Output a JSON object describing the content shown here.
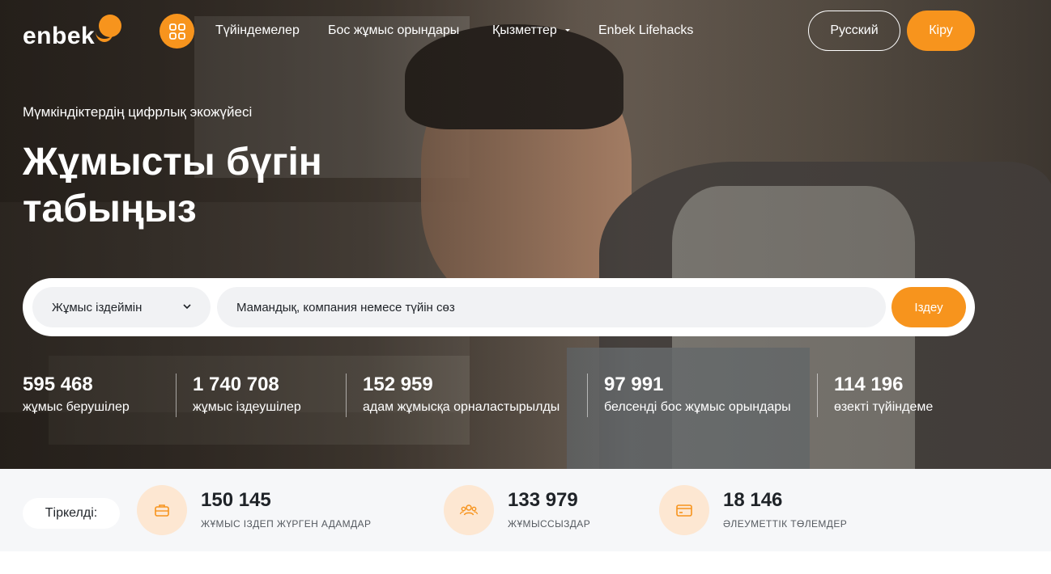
{
  "brand": {
    "logo_text": "enbek",
    "accent": "#f7941d"
  },
  "nav": {
    "apps_icon": "grid-icon",
    "links": [
      "Түйіндемелер",
      "Бос жұмыс орындары",
      "Қызметтер",
      "Enbek Lifehacks"
    ],
    "services_dropdown_icon": "caret-down-icon",
    "language_button": "Русский",
    "login_button": "Кіру"
  },
  "hero": {
    "subtitle": "Мүмкіндіктердің цифрлық экожүйесі",
    "headline": "Жұмысты бүгін табыңыз"
  },
  "search": {
    "select_value": "Жұмыс іздеймін",
    "input_placeholder": "Мамандық, компания немесе түйін сөз",
    "button_label": "Іздеу"
  },
  "stats": [
    {
      "value": "595 468",
      "label": "жұмыс берушілер"
    },
    {
      "value": "1 740 708",
      "label": "жұмыс іздеушілер"
    },
    {
      "value": "152 959",
      "label": "адам жұмысқа орналастырылды"
    },
    {
      "value": "97 991",
      "label": "белсенді бос жұмыс орындары"
    },
    {
      "value": "114 196",
      "label": "өзекті түйіндеме"
    }
  ],
  "registered": {
    "label": "Тіркелді:",
    "items": [
      {
        "icon": "briefcase-icon",
        "value": "150 145",
        "label": "ЖҰМЫС ІЗДЕП ЖҮРГЕН АДАМДАР"
      },
      {
        "icon": "users-icon",
        "value": "133 979",
        "label": "ЖҰМЫССЫЗДАР"
      },
      {
        "icon": "card-icon",
        "value": "18 146",
        "label": "ӘЛЕУМЕТТІК ТӨЛЕМДЕР"
      }
    ]
  }
}
